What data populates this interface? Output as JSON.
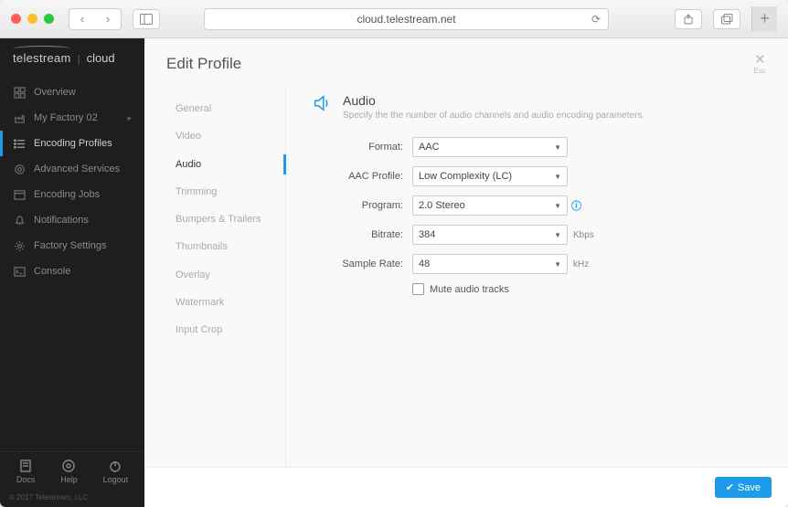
{
  "browser": {
    "url": "cloud.telestream.net"
  },
  "brand": {
    "name": "telestream",
    "suffix": "cloud"
  },
  "sidebar": {
    "items": [
      {
        "label": "Overview",
        "icon": "grid"
      },
      {
        "label": "My Factory 02",
        "icon": "factory",
        "chevron": true
      },
      {
        "label": "Encoding Profiles",
        "icon": "list",
        "active": true
      },
      {
        "label": "Advanced Services",
        "icon": "services"
      },
      {
        "label": "Encoding Jobs",
        "icon": "jobs"
      },
      {
        "label": "Notifications",
        "icon": "bell"
      },
      {
        "label": "Factory Settings",
        "icon": "gear"
      },
      {
        "label": "Console",
        "icon": "console"
      }
    ],
    "footer": [
      {
        "label": "Docs",
        "icon": "doc"
      },
      {
        "label": "Help",
        "icon": "help"
      },
      {
        "label": "Logout",
        "icon": "power"
      }
    ],
    "copyright": "© 2017 Telestream, LLC"
  },
  "main": {
    "title": "Edit Profile",
    "close_hint": "Esc",
    "tabs": [
      "General",
      "Video",
      "Audio",
      "Trimming",
      "Bumpers & Trailers",
      "Thumbnails",
      "Overlay",
      "Watermark",
      "Input Crop"
    ],
    "active_tab": "Audio",
    "section": {
      "title": "Audio",
      "desc": "Specify the the number of audio channels and audio encoding parameters."
    },
    "form": {
      "format": {
        "label": "Format:",
        "value": "AAC"
      },
      "aac_profile": {
        "label": "AAC Profile:",
        "value": "Low Complexity (LC)"
      },
      "program": {
        "label": "Program:",
        "value": "2.0 Stereo",
        "info": true
      },
      "bitrate": {
        "label": "Bitrate:",
        "value": "384",
        "unit": "Kbps"
      },
      "sample_rate": {
        "label": "Sample Rate:",
        "value": "48",
        "unit": "kHz"
      },
      "mute": {
        "label": "Mute audio tracks",
        "checked": false
      }
    },
    "save_label": "Save"
  }
}
